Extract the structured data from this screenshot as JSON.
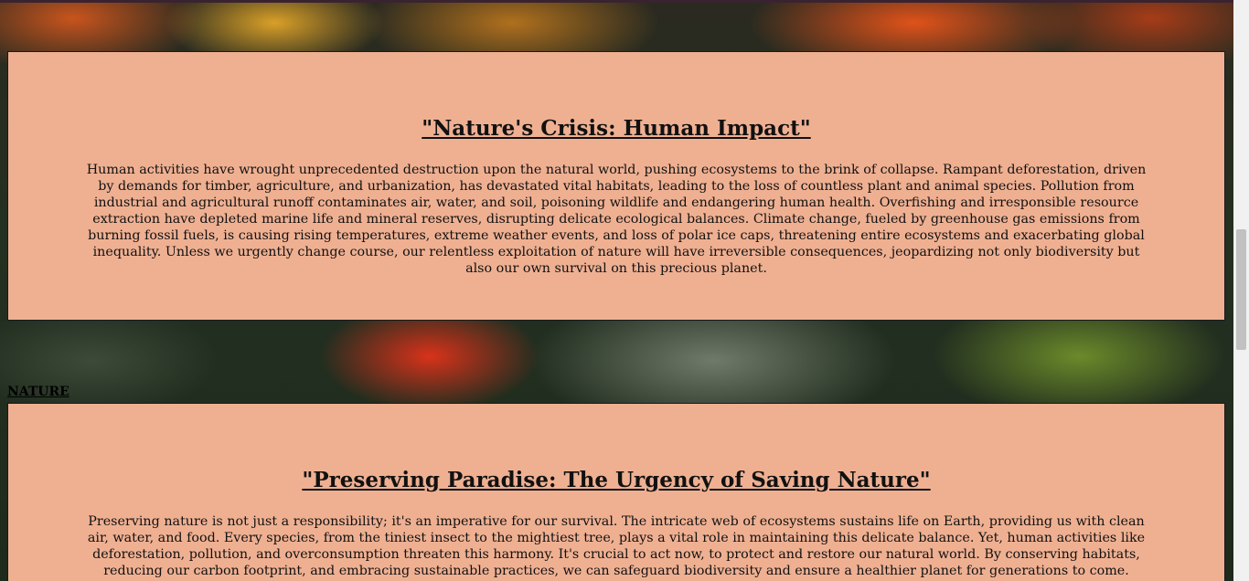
{
  "sections": [
    {
      "title": "\"Nature's Crisis: Human Impact\"",
      "body": "Human activities have wrought unprecedented destruction upon the natural world, pushing ecosystems to the brink of collapse. Rampant deforestation, driven by demands for timber, agriculture, and urbanization, has devastated vital habitats, leading to the loss of countless plant and animal species. Pollution from industrial and agricultural runoff contaminates air, water, and soil, poisoning wildlife and endangering human health. Overfishing and irresponsible resource extraction have depleted marine life and mineral reserves, disrupting delicate ecological balances. Climate change, fueled by greenhouse gas emissions from burning fossil fuels, is causing rising temperatures, extreme weather events, and loss of polar ice caps, threatening entire ecosystems and exacerbating global inequality. Unless we urgently change course, our relentless exploitation of nature will have irreversible consequences, jeopardizing not only biodiversity but also our own survival on this precious planet."
    },
    {
      "title": "\"Preserving Paradise: The Urgency of Saving Nature\"",
      "body": "Preserving nature is not just a responsibility; it's an imperative for our survival. The intricate web of ecosystems sustains life on Earth, providing us with clean air, water, and food. Every species, from the tiniest insect to the mightiest tree, plays a vital role in maintaining this delicate balance. Yet, human activities like deforestation, pollution, and overconsumption threaten this harmony. It's crucial to act now, to protect and restore our natural world. By conserving habitats, reducing our carbon footprint, and embracing sustainable practices, we can safeguard biodiversity and ensure a healthier planet for generations to come. Saving nature is not"
    }
  ],
  "nav": {
    "link_label": "NATURE"
  }
}
